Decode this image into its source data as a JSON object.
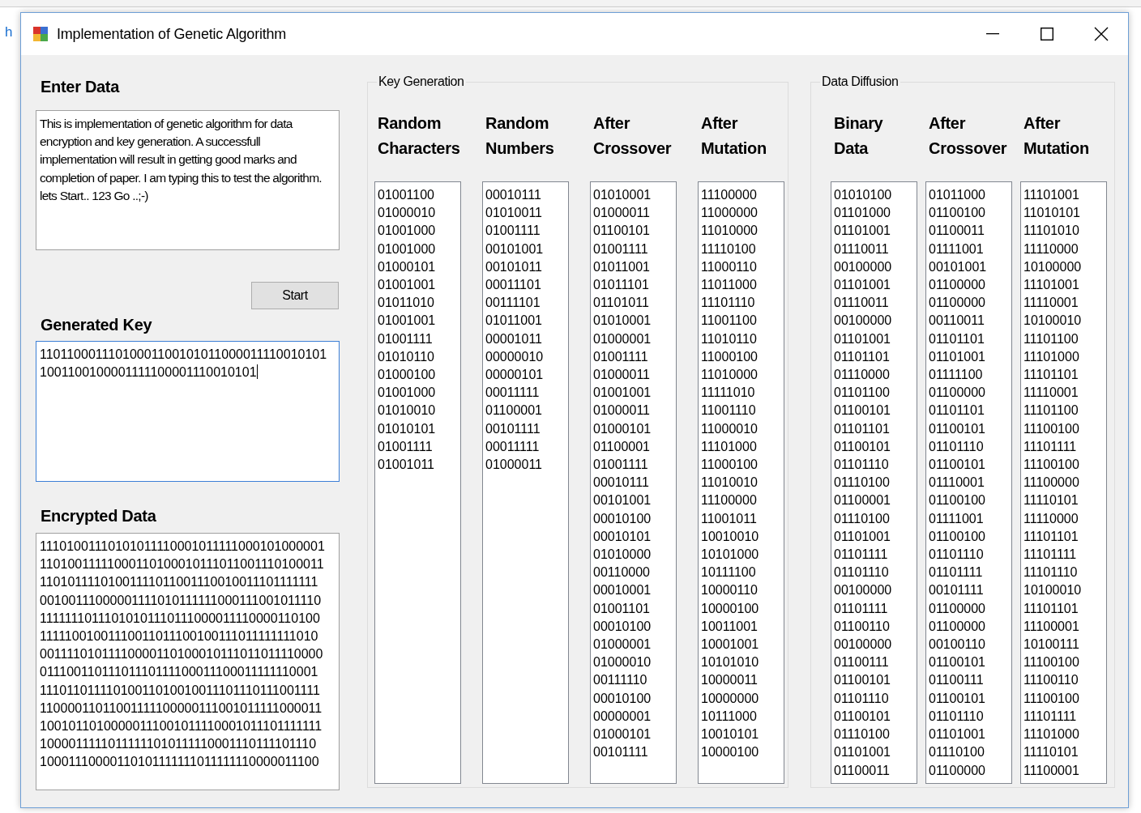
{
  "background_window": {
    "text": "h"
  },
  "window": {
    "title": "Implementation of Genetic Algorithm"
  },
  "enter_data": {
    "label": "Enter Data",
    "text": "This is implementation of genetic algorithm for data encryption and key generation. A successfull implementation will result in getting good marks and completion of paper. I am typing this to test the algorithm. lets Start.. 123 Go ..;-)"
  },
  "start_button": {
    "label": "Start"
  },
  "generated_key": {
    "label": "Generated Key",
    "focused": true,
    "lines": [
      "11011000111010001100101011000011110010101",
      "1001100100001111100001110010101"
    ]
  },
  "encrypted_data": {
    "label": "Encrypted Data",
    "lines": [
      "11101001110101011110001011111000101000001",
      "11010011111000110100010111011001110100011",
      "11010111101001111011001110010011101111111",
      "00100111000001111010111111000111001011110",
      "11111110111010101110111000011110000110100",
      "11111001001110011011100100111011111111010",
      "00111101011110000110100010111011011110000",
      "01110011011101110111100011100011111110001",
      "11101101111010011010010011101110111001111",
      "11000011011001111100000111001011111000011",
      "10010110100000111001011110001011101111111",
      "10000111110111111010111110001110111101110",
      "10001110000110101111111011111110000011100"
    ]
  },
  "groups": [
    {
      "title": "Key Generation",
      "columns": [
        {
          "header": "Random Characters",
          "values": [
            "01001100",
            "01000010",
            "01001000",
            "01001000",
            "01000101",
            "01001001",
            "01011010",
            "01001001",
            "01001111",
            "01010110",
            "01000100",
            "01001000",
            "01010010",
            "01010101",
            "01001111",
            "01001011"
          ]
        },
        {
          "header": "Random Numbers",
          "values": [
            "00010111",
            "01010011",
            "01001111",
            "00101001",
            "00101011",
            "00011101",
            "00111101",
            "01011001",
            "00001011",
            "00000010",
            "00000101",
            "00011111",
            "01100001",
            "00101111",
            "00011111",
            "01000011"
          ]
        },
        {
          "header": "After Crossover",
          "values": [
            "01010001",
            "01000011",
            "01100101",
            "01001111",
            "01011001",
            "01011101",
            "01101011",
            "01010001",
            "01000001",
            "01001111",
            "01000011",
            "01001001",
            "01000011",
            "01000101",
            "01100001",
            "01001111",
            "00010111",
            "00101001",
            "00010100",
            "00010101",
            "01010000",
            "00110000",
            "00010001",
            "01001101",
            "00010100",
            "01000001",
            "01000010",
            "00111110",
            "00010100",
            "00000001",
            "01000101",
            "00101111"
          ]
        },
        {
          "header": "After Mutation",
          "values": [
            "11100000",
            "11000000",
            "11010000",
            "11110100",
            "11000110",
            "11011000",
            "11101110",
            "11001100",
            "11010110",
            "11000100",
            "11010000",
            "11111010",
            "11001110",
            "11000010",
            "11101000",
            "11000100",
            "11010010",
            "11100000",
            "11001011",
            "10010010",
            "10101000",
            "10111100",
            "10000110",
            "10000100",
            "10011001",
            "10001001",
            "10101010",
            "10000011",
            "10000000",
            "10111000",
            "10010101",
            "10000100"
          ]
        }
      ]
    },
    {
      "title": "Data Diffusion",
      "columns": [
        {
          "header": "Binary Data",
          "values": [
            "01010100",
            "01101000",
            "01101001",
            "01110011",
            "00100000",
            "01101001",
            "01110011",
            "00100000",
            "01101001",
            "01101101",
            "01110000",
            "01101100",
            "01100101",
            "01101101",
            "01100101",
            "01101110",
            "01110100",
            "01100001",
            "01110100",
            "01101001",
            "01101111",
            "01101110",
            "00100000",
            "01101111",
            "01100110",
            "00100000",
            "01100111",
            "01100101",
            "01101110",
            "01100101",
            "01110100",
            "01101001",
            "01100011"
          ]
        },
        {
          "header": "After Crossover",
          "values": [
            "01011000",
            "01100100",
            "01100011",
            "01111001",
            "00101001",
            "01100000",
            "01100000",
            "00110011",
            "01101101",
            "01101001",
            "01111100",
            "01100000",
            "01101101",
            "01100101",
            "01101110",
            "01100101",
            "01110001",
            "01100100",
            "01111001",
            "01100100",
            "01101110",
            "01101111",
            "00101111",
            "01100000",
            "01100000",
            "00100110",
            "01100101",
            "01100111",
            "01100101",
            "01101110",
            "01101001",
            "01110100",
            "01100000"
          ]
        },
        {
          "header": "After Mutation",
          "values": [
            "11101001",
            "11010101",
            "11101010",
            "11110000",
            "10100000",
            "11101001",
            "11110001",
            "10100010",
            "11101100",
            "11101000",
            "11101101",
            "11110001",
            "11101100",
            "11100100",
            "11101111",
            "11100100",
            "11100000",
            "11110101",
            "11110000",
            "11101101",
            "11101111",
            "11101110",
            "10100010",
            "11101101",
            "11100001",
            "10100111",
            "11100100",
            "11100110",
            "11100100",
            "11101111",
            "11101000",
            "11110101",
            "11100001"
          ]
        }
      ]
    }
  ]
}
